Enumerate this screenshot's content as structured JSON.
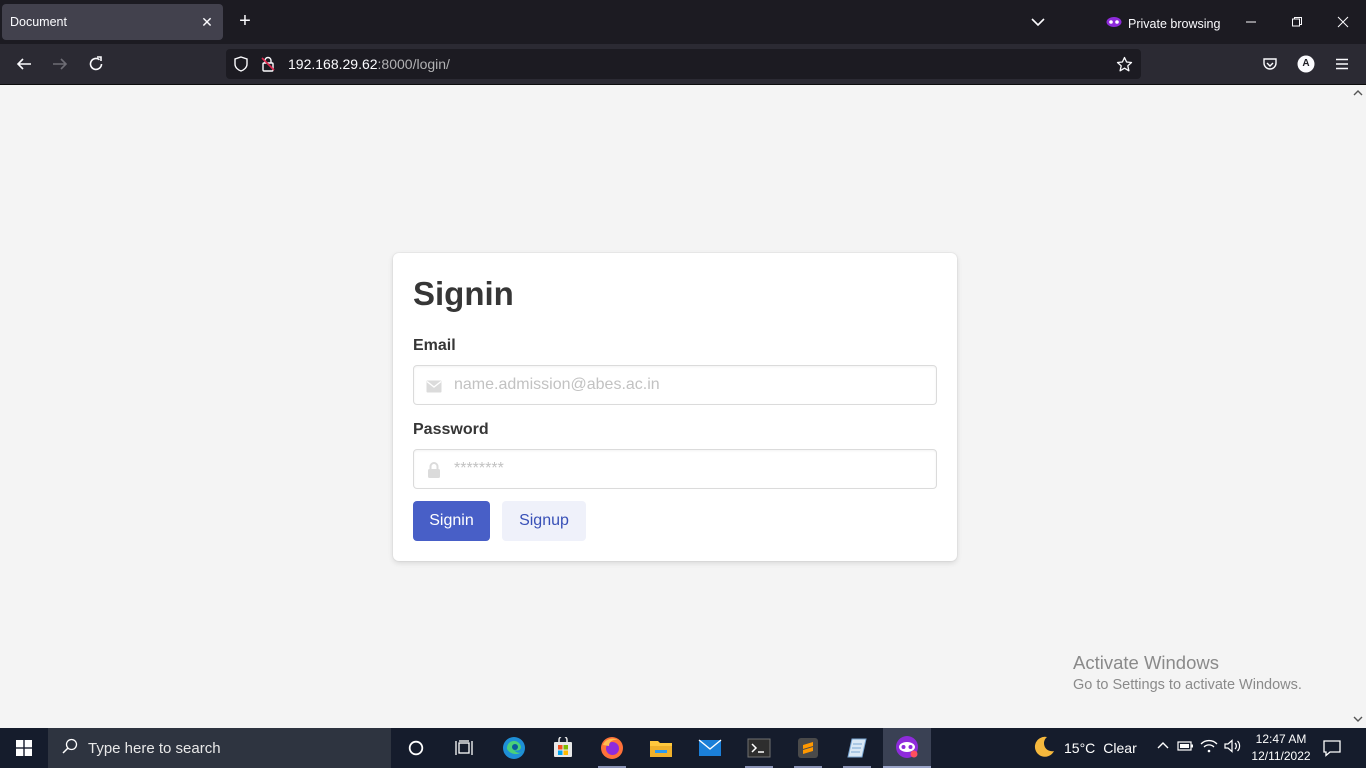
{
  "browser": {
    "tab_title": "Document",
    "private_label": "Private browsing",
    "url_host": "192.168.29.62",
    "url_rest": ":8000/login/",
    "account_initial": "A"
  },
  "page": {
    "title": "Signin",
    "email_label": "Email",
    "email_placeholder": "name.admission@abes.ac.in",
    "password_label": "Password",
    "password_placeholder": "********",
    "signin_button": "Signin",
    "signup_button": "Signup"
  },
  "watermark": {
    "title": "Activate Windows",
    "subtitle": "Go to Settings to activate Windows."
  },
  "taskbar": {
    "search_placeholder": "Type here to search",
    "weather_temp": "15°C",
    "weather_desc": "Clear",
    "time": "12:47 AM",
    "date": "12/11/2022"
  },
  "colors": {
    "primary_button": "#485fc7",
    "light_button": "#eff1fa",
    "browser_dark": "#1c1b22",
    "private_accent": "#8e2bdb"
  },
  "icons": [
    "chevron-down-icon",
    "private-mask-icon",
    "minimize-icon",
    "restore-icon",
    "close-icon",
    "back-icon",
    "forward-icon",
    "reload-icon",
    "shield-icon",
    "lock-insecure-icon",
    "star-icon",
    "pocket-icon",
    "menu-icon",
    "envelope-icon",
    "lock-icon",
    "windows-start-icon",
    "search-icon",
    "cortana-icon",
    "task-view-icon",
    "edge-icon",
    "store-icon",
    "firefox-icon",
    "file-explorer-icon",
    "mail-icon",
    "terminal-icon",
    "sublime-icon",
    "notepad-icon",
    "firefox-private-icon",
    "moon-icon",
    "notification-icon"
  ]
}
